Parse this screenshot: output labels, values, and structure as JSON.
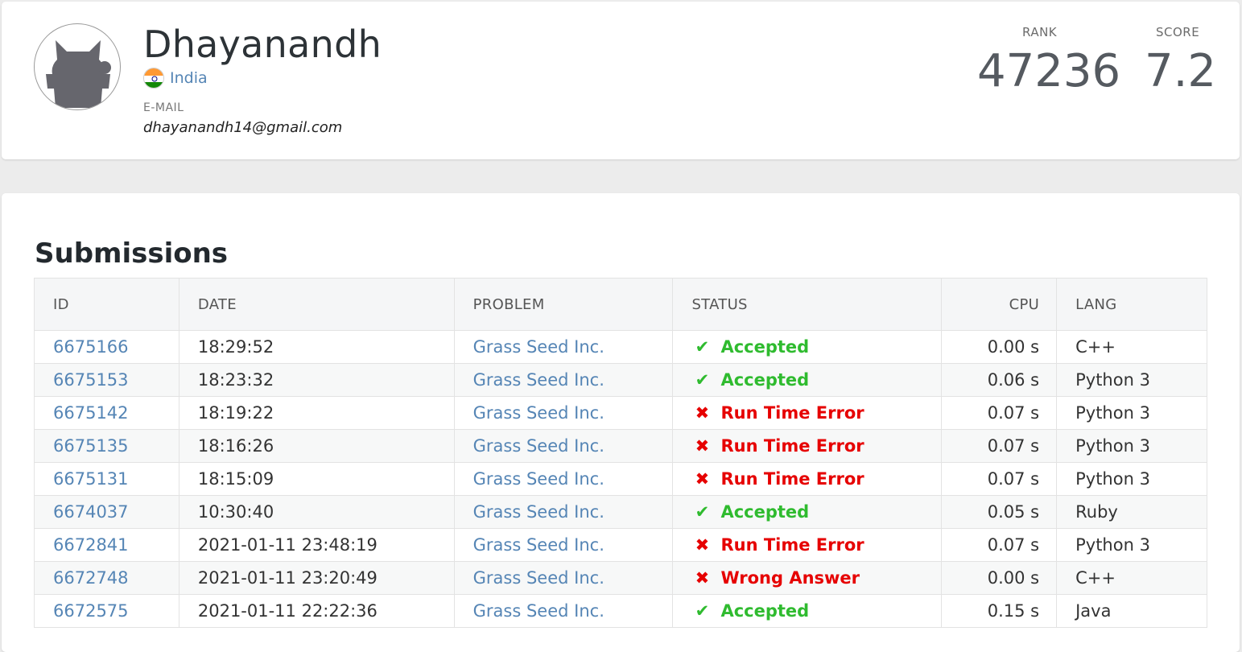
{
  "profile": {
    "name": "Dhayanandh",
    "country": "India",
    "email_label": "E-MAIL",
    "email": "dhayanandh14@gmail.com",
    "rank_label": "RANK",
    "rank": "47236",
    "score_label": "SCORE",
    "score": "7.2"
  },
  "submissions": {
    "title": "Submissions",
    "columns": [
      "ID",
      "DATE",
      "PROBLEM",
      "STATUS",
      "CPU",
      "LANG"
    ],
    "rows": [
      {
        "id": "6675166",
        "date": "18:29:52",
        "problem": "Grass Seed Inc.",
        "status": "Accepted",
        "ok": true,
        "cpu": "0.00 s",
        "lang": "C++"
      },
      {
        "id": "6675153",
        "date": "18:23:32",
        "problem": "Grass Seed Inc.",
        "status": "Accepted",
        "ok": true,
        "cpu": "0.06 s",
        "lang": "Python 3"
      },
      {
        "id": "6675142",
        "date": "18:19:22",
        "problem": "Grass Seed Inc.",
        "status": "Run Time Error",
        "ok": false,
        "cpu": "0.07 s",
        "lang": "Python 3"
      },
      {
        "id": "6675135",
        "date": "18:16:26",
        "problem": "Grass Seed Inc.",
        "status": "Run Time Error",
        "ok": false,
        "cpu": "0.07 s",
        "lang": "Python 3"
      },
      {
        "id": "6675131",
        "date": "18:15:09",
        "problem": "Grass Seed Inc.",
        "status": "Run Time Error",
        "ok": false,
        "cpu": "0.07 s",
        "lang": "Python 3"
      },
      {
        "id": "6674037",
        "date": "10:30:40",
        "problem": "Grass Seed Inc.",
        "status": "Accepted",
        "ok": true,
        "cpu": "0.05 s",
        "lang": "Ruby"
      },
      {
        "id": "6672841",
        "date": "2021-01-11 23:48:19",
        "problem": "Grass Seed Inc.",
        "status": "Run Time Error",
        "ok": false,
        "cpu": "0.07 s",
        "lang": "Python 3"
      },
      {
        "id": "6672748",
        "date": "2021-01-11 23:20:49",
        "problem": "Grass Seed Inc.",
        "status": "Wrong Answer",
        "ok": false,
        "cpu": "0.00 s",
        "lang": "C++"
      },
      {
        "id": "6672575",
        "date": "2021-01-11 22:22:36",
        "problem": "Grass Seed Inc.",
        "status": "Accepted",
        "ok": true,
        "cpu": "0.15 s",
        "lang": "Java"
      }
    ]
  },
  "icons": {
    "accepted": "check-icon",
    "error": "cross-icon",
    "flag": "india-flag-icon"
  },
  "colors": {
    "link": "#5585b5",
    "accepted": "#2fbb2f",
    "error": "#e60000"
  }
}
